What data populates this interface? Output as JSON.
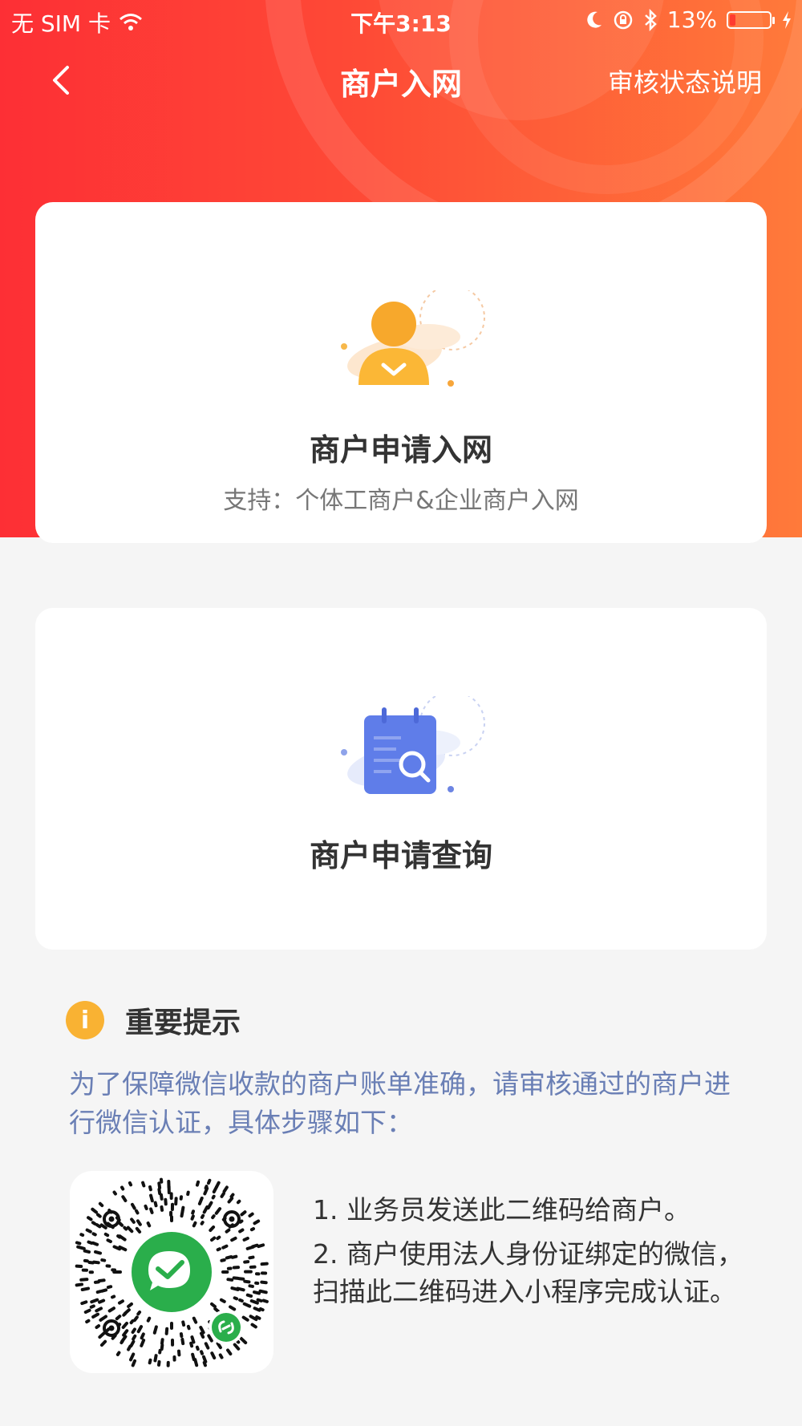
{
  "status_bar": {
    "carrier": "无 SIM 卡",
    "time": "下午3:13",
    "battery": "13%",
    "battery_level": 0.13
  },
  "nav": {
    "title": "商户入网",
    "help_link": "审核状态说明"
  },
  "cards": [
    {
      "title": "商户申请入网",
      "subtitle": "支持：个体工商户&企业商户入网",
      "icon": "merchant-user-icon"
    },
    {
      "title": "商户申请查询",
      "icon": "calendar-search-icon"
    }
  ],
  "notice": {
    "title": "重要提示",
    "icon_glyph": "i",
    "description": "为了保障微信收款的商户账单准确，请审核通过的商户进行微信认证，具体步骤如下：",
    "steps": [
      "1. 业务员发送此二维码给商户。",
      "2. 商户使用法人身份证绑定的微信，扫描此二维码进入小程序完成认证。"
    ]
  },
  "colors": {
    "header_gradient_start": "#fd2f35",
    "header_gradient_end": "#ff7a3a",
    "notice_text": "#6a7fb5",
    "notice_icon": "#f9b233",
    "wechat_green": "#2aae4b"
  }
}
